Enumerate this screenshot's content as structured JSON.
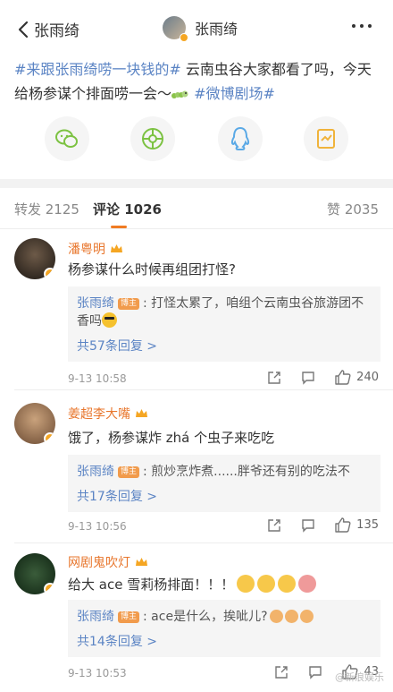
{
  "header": {
    "back_label": "张雨绮",
    "title": "张雨绮"
  },
  "post": {
    "tag1": "#来跟张雨绮唠一块钱的#",
    "text": " 云南虫谷大家都看了吗，今天给杨参谋个排面唠一会～",
    "tag2": " #微博剧场#"
  },
  "share_icons": [
    "wechat-icon",
    "moments-icon",
    "qq-icon",
    "qzone-icon"
  ],
  "tabs": {
    "repost": "转发 2125",
    "comments": "评论 1026",
    "likes": "赞 2035"
  },
  "comments": [
    {
      "name": "潘粤明",
      "text": "杨参谋什么时候再组团打怪?",
      "reply_name": "张雨绮",
      "reply_badge": "博主",
      "reply_text": ": 打怪太累了，咱组个云南虫谷旅游团不香吗",
      "reply_more": "共57条回复 >",
      "time": "9-13 10:58",
      "likes": "240"
    },
    {
      "name": "姜超李大嘴",
      "text": "饿了，杨参谋炸 zhá 个虫子来吃吃",
      "reply_name": "张雨绮",
      "reply_badge": "博主",
      "reply_text": ": 煎炒烹炸煮......胖爷还有别的吃法不",
      "reply_more": "共17条回复 >",
      "time": "9-13 10:56",
      "likes": "135"
    },
    {
      "name": "网剧鬼吹灯",
      "text": "给大 ace 雪莉杨排面！！！",
      "reply_name": "张雨绮",
      "reply_badge": "博主",
      "reply_text": ": ace是什么，挨呲儿?",
      "reply_more": "共14条回复 >",
      "time": "9-13 10:53",
      "likes": "43"
    }
  ],
  "watermark": "@新浪娱乐",
  "colors": {
    "link": "#5b84c4",
    "username": "#e8772e",
    "accent": "#f07b22"
  }
}
